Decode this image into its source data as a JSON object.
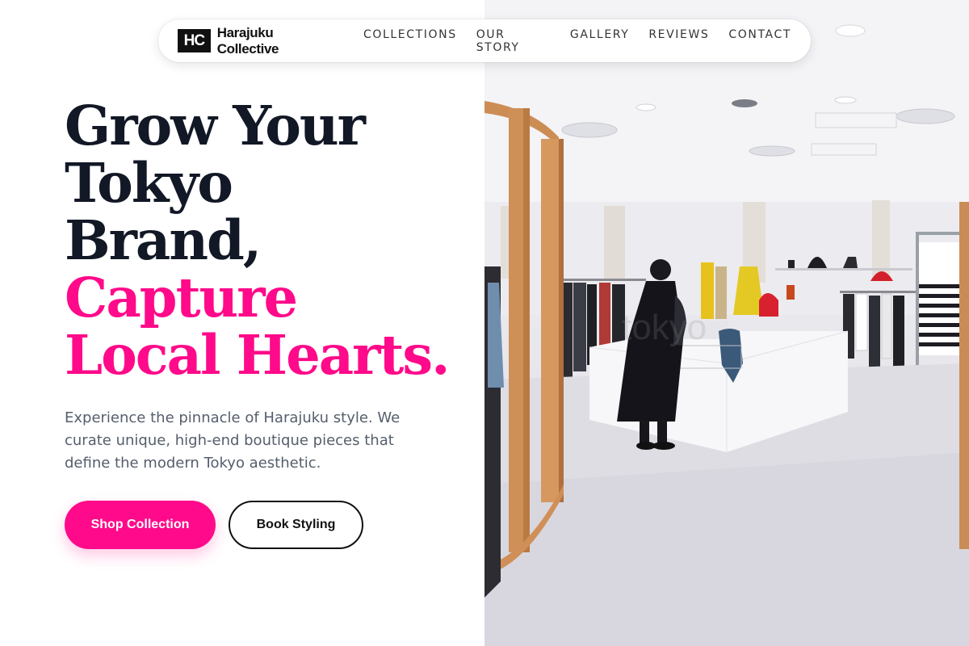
{
  "nav": {
    "logo_mark": "HC",
    "brand_name": "Harajuku Collective",
    "links": [
      "COLLECTIONS",
      "OUR STORY",
      "GALLERY",
      "REVIEWS",
      "CONTACT"
    ]
  },
  "hero": {
    "title_dark": [
      "Grow Your",
      "Tokyo",
      "Brand,"
    ],
    "title_accent": [
      "Capture",
      "Local Hearts."
    ],
    "description": "Experience the pinnacle of Harajuku style. We curate unique, high-end boutique pieces that define the modern Tokyo aesthetic.",
    "primary_button": "Shop Collection",
    "secondary_button": "Book Styling"
  },
  "photo": {
    "alt": "boutique store interior",
    "watermark": "tokyo"
  },
  "colors": {
    "accent": "#ff0a8a",
    "text_dark": "#121826",
    "text_muted": "#555e6c"
  }
}
